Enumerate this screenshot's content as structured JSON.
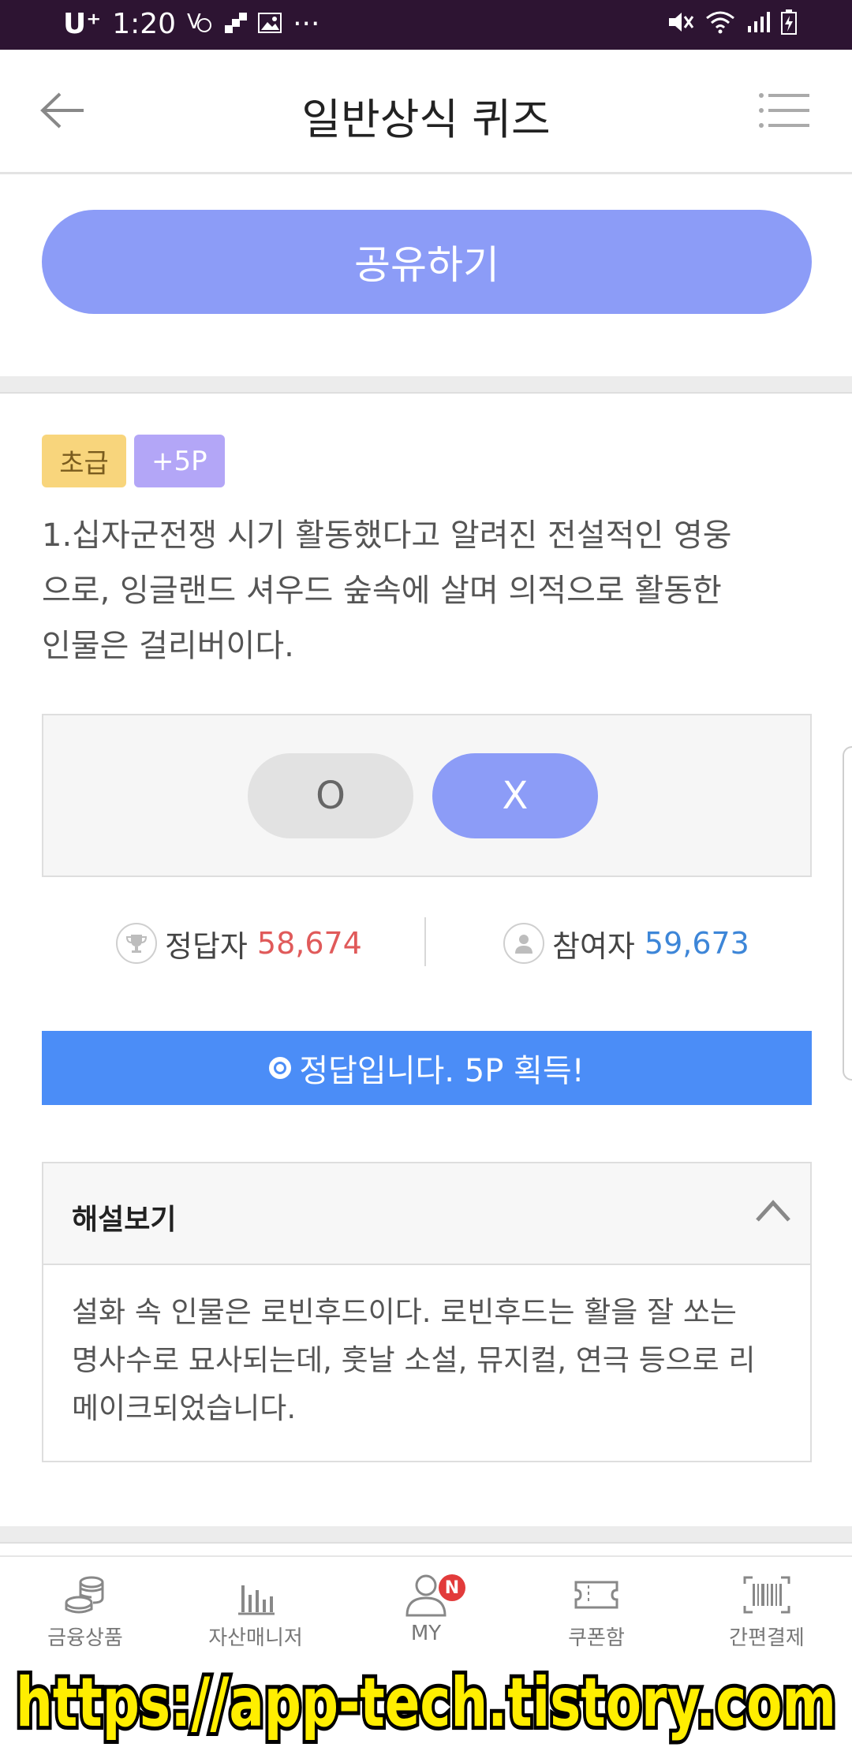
{
  "status_bar": {
    "carrier": "U⁺",
    "time": "1:20",
    "more": "···"
  },
  "header": {
    "title": "일반상식 퀴즈",
    "back_icon": "arrow-left-icon",
    "menu_icon": "list-menu-icon"
  },
  "share": {
    "label": "공유하기"
  },
  "quiz": {
    "level_badge": "초급",
    "points_badge": "+5P",
    "question_line1": "1.십자군전쟁 시기 활동했다고 알려진 전설적인 영웅",
    "question_line2": "으로, 잉글랜드 셔우드 숲속에 살며 의적으로 활동한",
    "question_line3": "인물은 걸리버이다.",
    "option_o": "O",
    "option_x": "X",
    "selected_option": "X"
  },
  "stats": {
    "correct_label": "정답자",
    "correct_count": "58,674",
    "participants_label": "참여자",
    "participants_count": "59,673"
  },
  "result": {
    "text": "정답입니다. 5P 획득!"
  },
  "explanation": {
    "title": "해설보기",
    "line1": "설화 속 인물은 로빈후드이다. 로빈후드는 활을 잘 쏘는",
    "line2": "명사수로 묘사되는데, 훗날 소설, 뮤지컬, 연극 등으로 리",
    "line3": "메이크되었습니다."
  },
  "bottom_nav": {
    "items": [
      {
        "label": "금융상품",
        "icon": "coins-icon"
      },
      {
        "label": "자산매니저",
        "icon": "bar-chart-icon"
      },
      {
        "label": "MY",
        "icon": "user-icon",
        "badge": "N"
      },
      {
        "label": "쿠폰함",
        "icon": "ticket-icon"
      },
      {
        "label": "간편결제",
        "icon": "barcode-icon"
      }
    ]
  },
  "watermark": {
    "text": "https://app-tech.tistory.com"
  },
  "colors": {
    "status_bar": "#2d1432",
    "accent": "#8c9cf7",
    "result_blue": "#4b8df7",
    "correct_red": "#e05a5a",
    "participants_blue": "#3d86d8",
    "badge_yellow": "#f8d57c",
    "badge_purple": "#b3a6f7",
    "watermark_yellow": "#ffee00"
  }
}
